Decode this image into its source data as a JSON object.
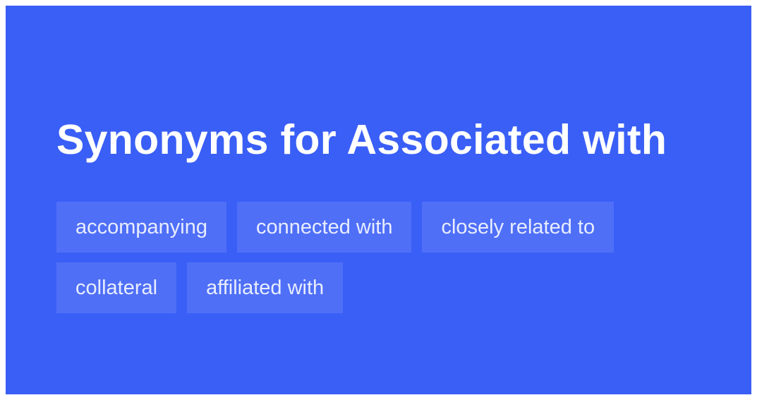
{
  "title": "Synonyms for Associated with",
  "synonyms": [
    "accompanying",
    "connected with",
    "closely related to",
    "collateral",
    "affiliated with"
  ],
  "colors": {
    "background": "#3a5ff6",
    "chip_background": "#4f6ff7",
    "text": "#ffffff"
  }
}
